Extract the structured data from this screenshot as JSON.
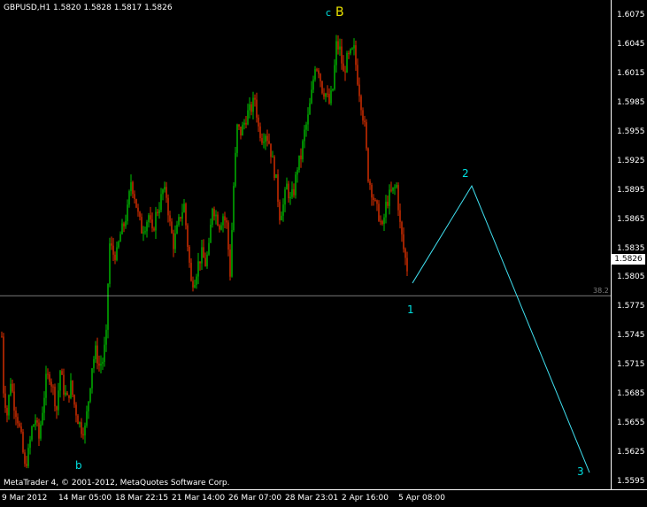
{
  "header": {
    "symbol_line": "GBPUSD,H1  1.5820 1.5828 1.5817 1.5826"
  },
  "footer": {
    "copyright": "MetaTrader 4, © 2001-2012, MetaQuotes Software Corp."
  },
  "price_axis": {
    "ticks": [
      "1.6075",
      "1.6045",
      "1.6015",
      "1.5985",
      "1.5955",
      "1.5925",
      "1.5895",
      "1.5865",
      "1.5835",
      "1.5805",
      "1.5775",
      "1.5745",
      "1.5715",
      "1.5685",
      "1.5655",
      "1.5625",
      "1.5595"
    ],
    "current_price": "1.5826"
  },
  "time_axis": {
    "ticks": [
      "9 Mar 2012",
      "14 Mar 05:00",
      "18 Mar 22:15",
      "21 Mar 14:00",
      "26 Mar 07:00",
      "28 Mar 23:01",
      "2 Apr 16:00",
      "5 Apr 08:00"
    ]
  },
  "fib_level": {
    "label": "38.2",
    "price": 1.5787,
    "color": "#c0c0c0"
  },
  "wave_labels": {
    "b_lower": "b",
    "c_top": "c",
    "B_top": "B",
    "w1": "1",
    "w2": "2",
    "w3": "3"
  },
  "colors": {
    "background": "#000000",
    "bull_candle": "#00c000",
    "bear_candle": "#e03000",
    "wave_label_cyan": "#00e0e0",
    "wave_label_yellow": "#e8e000",
    "projection_line": "#40e0f0"
  },
  "chart_data": {
    "type": "line",
    "title": "GBPUSD,H1",
    "ylim": [
      1.5595,
      1.6075
    ],
    "price_path": [
      [
        0,
        1.58
      ],
      [
        4,
        1.569
      ],
      [
        8,
        1.5665
      ],
      [
        12,
        1.57
      ],
      [
        16,
        1.5675
      ],
      [
        20,
        1.566
      ],
      [
        24,
        1.564
      ],
      [
        28,
        1.561
      ],
      [
        32,
        1.5625
      ],
      [
        36,
        1.565
      ],
      [
        40,
        1.566
      ],
      [
        44,
        1.564
      ],
      [
        48,
        1.567
      ],
      [
        52,
        1.57
      ],
      [
        56,
        1.5705
      ],
      [
        60,
        1.569
      ],
      [
        64,
        1.567
      ],
      [
        68,
        1.571
      ],
      [
        72,
        1.569
      ],
      [
        76,
        1.568
      ],
      [
        80,
        1.5695
      ],
      [
        84,
        1.5675
      ],
      [
        88,
        1.566
      ],
      [
        92,
        1.565
      ],
      [
        96,
        1.565
      ],
      [
        100,
        1.568
      ],
      [
        104,
        1.5715
      ],
      [
        108,
        1.573
      ],
      [
        112,
        1.5715
      ],
      [
        116,
        1.572
      ],
      [
        120,
        1.5745
      ],
      [
        122,
        1.58
      ],
      [
        124,
        1.584
      ],
      [
        128,
        1.583
      ],
      [
        132,
        1.583
      ],
      [
        136,
        1.585
      ],
      [
        140,
        1.586
      ],
      [
        144,
        1.5875
      ],
      [
        148,
        1.5905
      ],
      [
        152,
        1.589
      ],
      [
        156,
        1.587
      ],
      [
        160,
        1.5855
      ],
      [
        164,
        1.586
      ],
      [
        168,
        1.587
      ],
      [
        172,
        1.585
      ],
      [
        176,
        1.587
      ],
      [
        180,
        1.588
      ],
      [
        184,
        1.5895
      ],
      [
        188,
        1.589
      ],
      [
        192,
        1.586
      ],
      [
        196,
        1.584
      ],
      [
        200,
        1.5855
      ],
      [
        204,
        1.587
      ],
      [
        208,
        1.588
      ],
      [
        212,
        1.584
      ],
      [
        216,
        1.58
      ],
      [
        220,
        1.5805
      ],
      [
        224,
        1.582
      ],
      [
        228,
        1.583
      ],
      [
        232,
        1.582
      ],
      [
        236,
        1.5835
      ],
      [
        240,
        1.588
      ],
      [
        244,
        1.587
      ],
      [
        248,
        1.586
      ],
      [
        252,
        1.587
      ],
      [
        256,
        1.586
      ],
      [
        260,
        1.581
      ],
      [
        264,
        1.59
      ],
      [
        268,
        1.596
      ],
      [
        272,
        1.5955
      ],
      [
        276,
        1.5965
      ],
      [
        280,
        1.5975
      ],
      [
        284,
        1.598
      ],
      [
        288,
        1.599
      ],
      [
        292,
        1.596
      ],
      [
        296,
        1.595
      ],
      [
        300,
        1.5955
      ],
      [
        304,
        1.5945
      ],
      [
        308,
        1.5925
      ],
      [
        312,
        1.5905
      ],
      [
        316,
        1.587
      ],
      [
        320,
        1.588
      ],
      [
        324,
        1.59
      ],
      [
        328,
        1.5885
      ],
      [
        332,
        1.5895
      ],
      [
        336,
        1.592
      ],
      [
        340,
        1.593
      ],
      [
        344,
        1.5955
      ],
      [
        348,
        1.597
      ],
      [
        352,
        1.5995
      ],
      [
        356,
        1.6025
      ],
      [
        360,
        1.602
      ],
      [
        364,
        1.6
      ],
      [
        368,
        1.5995
      ],
      [
        372,
        1.5985
      ],
      [
        376,
        1.6
      ],
      [
        380,
        1.6045
      ],
      [
        384,
        1.604
      ],
      [
        388,
        1.6015
      ],
      [
        392,
        1.603
      ],
      [
        396,
        1.6035
      ],
      [
        400,
        1.604
      ],
      [
        404,
        1.601
      ],
      [
        408,
        1.5985
      ],
      [
        412,
        1.596
      ],
      [
        416,
        1.591
      ],
      [
        420,
        1.5895
      ],
      [
        424,
        1.588
      ],
      [
        428,
        1.587
      ],
      [
        432,
        1.5855
      ],
      [
        436,
        1.588
      ],
      [
        440,
        1.589
      ],
      [
        444,
        1.5895
      ],
      [
        448,
        1.59
      ],
      [
        452,
        1.586
      ],
      [
        456,
        1.5835
      ],
      [
        460,
        1.5815
      ]
    ],
    "projection_path": [
      [
        466,
        1.58
      ],
      [
        533,
        1.59
      ],
      [
        666,
        1.5605
      ]
    ]
  }
}
